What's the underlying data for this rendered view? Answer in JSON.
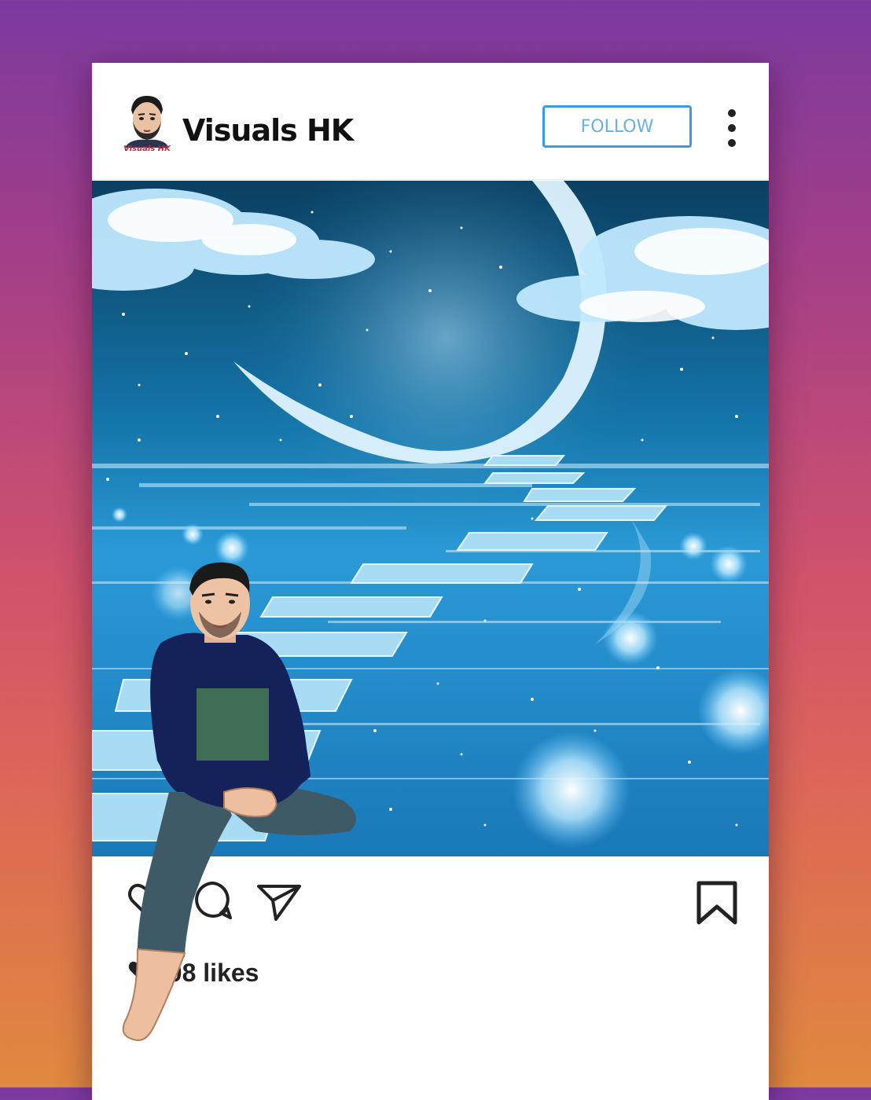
{
  "post": {
    "username": "Visuals HK",
    "avatar_logo_text": "Visuals HK",
    "follow_label": "FOLLOW",
    "likes_text": "508 likes"
  },
  "icons": {
    "more": "more-vertical-icon",
    "like": "heart-icon",
    "comment": "comment-icon",
    "share": "send-icon",
    "save": "bookmark-icon"
  },
  "colors": {
    "follow_border": "#3a9be0",
    "follow_text": "#6ab0e6",
    "sky_dark": "#0e4d72",
    "sky_light": "#3ab0e8"
  }
}
